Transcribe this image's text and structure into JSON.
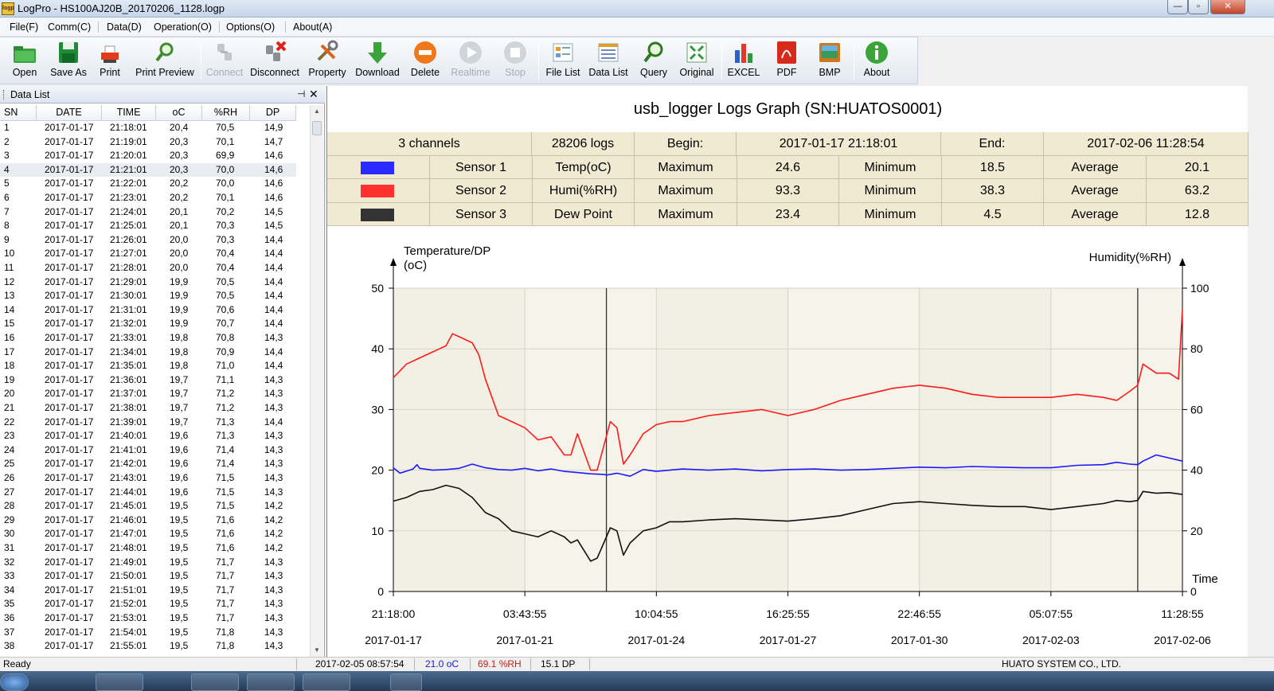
{
  "window": {
    "title": "LogPro - HS100AJ20B_20170206_1128.logp",
    "app_icon_text": "logp",
    "buttons": {
      "minimize": "—",
      "maximize": "▫",
      "close": "✕"
    }
  },
  "menu": [
    "File(F)",
    "Comm(C)",
    "Data(D)",
    "Operation(O)",
    "Options(O)",
    "About(A)"
  ],
  "toolbar": [
    {
      "id": "open",
      "label": "Open",
      "icon": "folder-icon",
      "enabled": true
    },
    {
      "id": "save-as",
      "label": "Save As",
      "icon": "floppy-icon",
      "enabled": true
    },
    {
      "id": "print",
      "label": "Print",
      "icon": "printer-icon",
      "enabled": true
    },
    {
      "id": "print-preview",
      "label": "Print Preview",
      "icon": "magnifier-icon",
      "enabled": true
    },
    {
      "id": "connect",
      "label": "Connect",
      "icon": "connect-icon",
      "enabled": false
    },
    {
      "id": "disconnect",
      "label": "Disconnect",
      "icon": "disconnect-icon",
      "enabled": true
    },
    {
      "id": "property",
      "label": "Property",
      "icon": "tools-icon",
      "enabled": true
    },
    {
      "id": "download",
      "label": "Download",
      "icon": "download-arrow-icon",
      "enabled": true
    },
    {
      "id": "delete",
      "label": "Delete",
      "icon": "delete-icon",
      "enabled": true
    },
    {
      "id": "realtime",
      "label": "Realtime",
      "icon": "play-icon",
      "enabled": false
    },
    {
      "id": "stop",
      "label": "Stop",
      "icon": "stop-icon",
      "enabled": false
    },
    {
      "id": "file-list",
      "label": "File List",
      "icon": "file-list-icon",
      "enabled": true
    },
    {
      "id": "data-list",
      "label": "Data List",
      "icon": "data-list-icon",
      "enabled": true
    },
    {
      "id": "query",
      "label": "Query",
      "icon": "query-icon",
      "enabled": true
    },
    {
      "id": "original",
      "label": "Original",
      "icon": "original-size-icon",
      "enabled": true
    },
    {
      "id": "excel",
      "label": "EXCEL",
      "icon": "bar-chart-icon",
      "enabled": true
    },
    {
      "id": "pdf",
      "label": "PDF",
      "icon": "pdf-icon",
      "enabled": true
    },
    {
      "id": "bmp",
      "label": "BMP",
      "icon": "image-icon",
      "enabled": true
    },
    {
      "id": "about",
      "label": "About",
      "icon": "info-icon",
      "enabled": true
    }
  ],
  "data_list": {
    "title": "Data List",
    "pin": "⊣",
    "close": "✕",
    "columns": [
      "SN",
      "DATE",
      "TIME",
      "oC",
      "%RH",
      "DP"
    ],
    "selected_row": 4,
    "rows": [
      [
        "1",
        "2017-01-17",
        "21:18:01",
        "20,4",
        "70,5",
        "14,9"
      ],
      [
        "2",
        "2017-01-17",
        "21:19:01",
        "20,3",
        "70,1",
        "14,7"
      ],
      [
        "3",
        "2017-01-17",
        "21:20:01",
        "20,3",
        "69,9",
        "14,6"
      ],
      [
        "4",
        "2017-01-17",
        "21:21:01",
        "20,3",
        "70,0",
        "14,6"
      ],
      [
        "5",
        "2017-01-17",
        "21:22:01",
        "20,2",
        "70,0",
        "14,6"
      ],
      [
        "6",
        "2017-01-17",
        "21:23:01",
        "20,2",
        "70,1",
        "14,6"
      ],
      [
        "7",
        "2017-01-17",
        "21:24:01",
        "20,1",
        "70,2",
        "14,5"
      ],
      [
        "8",
        "2017-01-17",
        "21:25:01",
        "20,1",
        "70,3",
        "14,5"
      ],
      [
        "9",
        "2017-01-17",
        "21:26:01",
        "20,0",
        "70,3",
        "14,4"
      ],
      [
        "10",
        "2017-01-17",
        "21:27:01",
        "20,0",
        "70,4",
        "14,4"
      ],
      [
        "11",
        "2017-01-17",
        "21:28:01",
        "20,0",
        "70,4",
        "14,4"
      ],
      [
        "12",
        "2017-01-17",
        "21:29:01",
        "19,9",
        "70,5",
        "14,4"
      ],
      [
        "13",
        "2017-01-17",
        "21:30:01",
        "19,9",
        "70,5",
        "14,4"
      ],
      [
        "14",
        "2017-01-17",
        "21:31:01",
        "19,9",
        "70,6",
        "14,4"
      ],
      [
        "15",
        "2017-01-17",
        "21:32:01",
        "19,9",
        "70,7",
        "14,4"
      ],
      [
        "16",
        "2017-01-17",
        "21:33:01",
        "19,8",
        "70,8",
        "14,3"
      ],
      [
        "17",
        "2017-01-17",
        "21:34:01",
        "19,8",
        "70,9",
        "14,4"
      ],
      [
        "18",
        "2017-01-17",
        "21:35:01",
        "19,8",
        "71,0",
        "14,4"
      ],
      [
        "19",
        "2017-01-17",
        "21:36:01",
        "19,7",
        "71,1",
        "14,3"
      ],
      [
        "20",
        "2017-01-17",
        "21:37:01",
        "19,7",
        "71,2",
        "14,3"
      ],
      [
        "21",
        "2017-01-17",
        "21:38:01",
        "19,7",
        "71,2",
        "14,3"
      ],
      [
        "22",
        "2017-01-17",
        "21:39:01",
        "19,7",
        "71,3",
        "14,4"
      ],
      [
        "23",
        "2017-01-17",
        "21:40:01",
        "19,6",
        "71,3",
        "14,3"
      ],
      [
        "24",
        "2017-01-17",
        "21:41:01",
        "19,6",
        "71,4",
        "14,3"
      ],
      [
        "25",
        "2017-01-17",
        "21:42:01",
        "19,6",
        "71,4",
        "14,3"
      ],
      [
        "26",
        "2017-01-17",
        "21:43:01",
        "19,6",
        "71,5",
        "14,3"
      ],
      [
        "27",
        "2017-01-17",
        "21:44:01",
        "19,6",
        "71,5",
        "14,3"
      ],
      [
        "28",
        "2017-01-17",
        "21:45:01",
        "19,5",
        "71,5",
        "14,2"
      ],
      [
        "29",
        "2017-01-17",
        "21:46:01",
        "19,5",
        "71,6",
        "14,2"
      ],
      [
        "30",
        "2017-01-17",
        "21:47:01",
        "19,5",
        "71,6",
        "14,2"
      ],
      [
        "31",
        "2017-01-17",
        "21:48:01",
        "19,5",
        "71,6",
        "14,2"
      ],
      [
        "32",
        "2017-01-17",
        "21:49:01",
        "19,5",
        "71,7",
        "14,3"
      ],
      [
        "33",
        "2017-01-17",
        "21:50:01",
        "19,5",
        "71,7",
        "14,3"
      ],
      [
        "34",
        "2017-01-17",
        "21:51:01",
        "19,5",
        "71,7",
        "14,3"
      ],
      [
        "35",
        "2017-01-17",
        "21:52:01",
        "19,5",
        "71,7",
        "14,3"
      ],
      [
        "36",
        "2017-01-17",
        "21:53:01",
        "19,5",
        "71,7",
        "14,3"
      ],
      [
        "37",
        "2017-01-17",
        "21:54:01",
        "19,5",
        "71,8",
        "14,3"
      ],
      [
        "38",
        "2017-01-17",
        "21:55:01",
        "19,5",
        "71,8",
        "14,3"
      ]
    ]
  },
  "graph": {
    "title": "usb_logger Logs Graph (SN:HUATOS0001)",
    "summary": {
      "channels": "3 channels",
      "logs": "28206 logs",
      "begin_label": "Begin:",
      "begin": "2017-01-17 21:18:01",
      "end_label": "End:",
      "end": "2017-02-06 11:28:54"
    },
    "sensors": [
      {
        "name": "Sensor 1",
        "type": "Temp(oC)",
        "max_label": "Maximum",
        "max": "24.6",
        "min_label": "Minimum",
        "min": "18.5",
        "avg_label": "Average",
        "avg": "20.1",
        "color": "#2b2bff"
      },
      {
        "name": "Sensor 2",
        "type": "Humi(%RH)",
        "max_label": "Maximum",
        "max": "93.3",
        "min_label": "Minimum",
        "min": "38.3",
        "avg_label": "Average",
        "avg": "63.2",
        "color": "#ff3030"
      },
      {
        "name": "Sensor 3",
        "type": "Dew Point",
        "max_label": "Maximum",
        "max": "23.4",
        "min_label": "Minimum",
        "min": "4.5",
        "avg_label": "Average",
        "avg": "12.8",
        "color": "#333333"
      }
    ]
  },
  "chart_data": {
    "type": "line",
    "ylabel": "Temperature/DP\n(oC)",
    "ylabel_right": "Humidity(%RH)",
    "xlabel": "Time",
    "ylim": [
      0,
      50
    ],
    "ylim_right": [
      0,
      100
    ],
    "y_ticks": [
      0,
      10,
      20,
      30,
      40,
      50
    ],
    "y_ticks_right": [
      0,
      20,
      40,
      60,
      80,
      100
    ],
    "x_ticks": [
      {
        "time": "21:18:00",
        "date": "2017-01-17"
      },
      {
        "time": "03:43:55",
        "date": "2017-01-21"
      },
      {
        "time": "10:04:55",
        "date": "2017-01-24"
      },
      {
        "time": "16:25:55",
        "date": "2017-01-27"
      },
      {
        "time": "22:46:55",
        "date": "2017-01-30"
      },
      {
        "time": "05:07:55",
        "date": "2017-02-03"
      },
      {
        "time": "11:28:55",
        "date": "2017-02-06"
      }
    ],
    "x_unit": "x-tick index",
    "x_range": [
      0,
      6
    ],
    "markers_x": [
      1.62,
      5.66
    ],
    "grid": true,
    "series": [
      {
        "name": "Temp(oC)",
        "axis": "left",
        "color": "#1a1aff",
        "x": [
          0,
          0.05,
          0.15,
          0.18,
          0.2,
          0.3,
          0.4,
          0.5,
          0.6,
          0.7,
          0.8,
          0.9,
          1.0,
          1.1,
          1.2,
          1.3,
          1.4,
          1.5,
          1.6,
          1.62,
          1.7,
          1.8,
          1.9,
          2.0,
          2.2,
          2.4,
          2.6,
          2.8,
          3.0,
          3.2,
          3.4,
          3.6,
          3.8,
          4.0,
          4.2,
          4.4,
          4.6,
          4.8,
          5.0,
          5.2,
          5.4,
          5.5,
          5.6,
          5.66,
          5.7,
          5.8,
          5.9,
          6.0
        ],
        "y": [
          20.4,
          19.5,
          20.2,
          20.9,
          20.3,
          20.0,
          20.1,
          20.3,
          21.0,
          20.4,
          20.1,
          20.0,
          20.3,
          19.9,
          20.2,
          19.8,
          19.6,
          19.4,
          19.3,
          19.2,
          19.5,
          19.0,
          20.1,
          19.8,
          20.2,
          20.0,
          20.2,
          19.9,
          20.1,
          20.2,
          20.0,
          20.1,
          20.3,
          20.5,
          20.4,
          20.6,
          20.5,
          20.4,
          20.4,
          20.8,
          20.9,
          21.3,
          21.0,
          20.9,
          21.5,
          22.5,
          22.0,
          21.5
        ]
      },
      {
        "name": "Humi(%RH)",
        "axis": "right",
        "color": "#ff1a1a",
        "x": [
          0,
          0.1,
          0.2,
          0.3,
          0.35,
          0.4,
          0.45,
          0.5,
          0.6,
          0.65,
          0.7,
          0.8,
          0.9,
          1.0,
          1.05,
          1.1,
          1.2,
          1.3,
          1.35,
          1.4,
          1.5,
          1.55,
          1.6,
          1.65,
          1.7,
          1.75,
          1.8,
          1.9,
          2.0,
          2.1,
          2.2,
          2.4,
          2.6,
          2.8,
          3.0,
          3.2,
          3.4,
          3.6,
          3.8,
          4.0,
          4.2,
          4.4,
          4.6,
          4.8,
          5.0,
          5.2,
          5.4,
          5.5,
          5.6,
          5.66,
          5.7,
          5.8,
          5.9,
          5.97,
          6.0
        ],
        "y": [
          70.5,
          75,
          77,
          79,
          80,
          81,
          85,
          84,
          82,
          78,
          70,
          58,
          56,
          54,
          52,
          50,
          51,
          45,
          45,
          52,
          40,
          40,
          48,
          56,
          54,
          42,
          45,
          52,
          55,
          56,
          56,
          58,
          59,
          60,
          58,
          60,
          63,
          65,
          67,
          68,
          67,
          65,
          64,
          64,
          64,
          65,
          64,
          63,
          66,
          68,
          75,
          72,
          72,
          70,
          93
        ]
      },
      {
        "name": "Dew Point",
        "axis": "left",
        "color": "#111111",
        "x": [
          0,
          0.1,
          0.2,
          0.3,
          0.4,
          0.5,
          0.6,
          0.7,
          0.8,
          0.9,
          1.0,
          1.1,
          1.2,
          1.3,
          1.35,
          1.4,
          1.5,
          1.55,
          1.6,
          1.65,
          1.7,
          1.75,
          1.8,
          1.9,
          2.0,
          2.1,
          2.2,
          2.4,
          2.6,
          2.8,
          3.0,
          3.2,
          3.4,
          3.6,
          3.8,
          4.0,
          4.2,
          4.4,
          4.6,
          4.8,
          5.0,
          5.2,
          5.4,
          5.5,
          5.6,
          5.66,
          5.7,
          5.8,
          5.9,
          6.0
        ],
        "y": [
          14.9,
          15.5,
          16.5,
          16.8,
          17.5,
          17.0,
          15.5,
          13,
          12,
          10,
          9.5,
          9,
          10,
          9,
          8,
          8.5,
          5,
          5.5,
          8,
          10.5,
          10,
          6,
          8,
          10,
          10.5,
          11.5,
          11.5,
          11.8,
          12,
          11.8,
          11.6,
          12.0,
          12.5,
          13.5,
          14.5,
          14.8,
          14.5,
          14.2,
          14.0,
          14.0,
          13.5,
          14.0,
          14.5,
          15.0,
          14.8,
          15.0,
          16.5,
          16.2,
          16.3,
          16.0
        ]
      }
    ]
  },
  "status": {
    "ready": "Ready",
    "datetime": "2017-02-05 08:57:54",
    "temp": "21.0 oC",
    "humi": "69.1 %RH",
    "dp": "15.1 DP",
    "company": "HUATO SYSTEM CO., LTD."
  }
}
